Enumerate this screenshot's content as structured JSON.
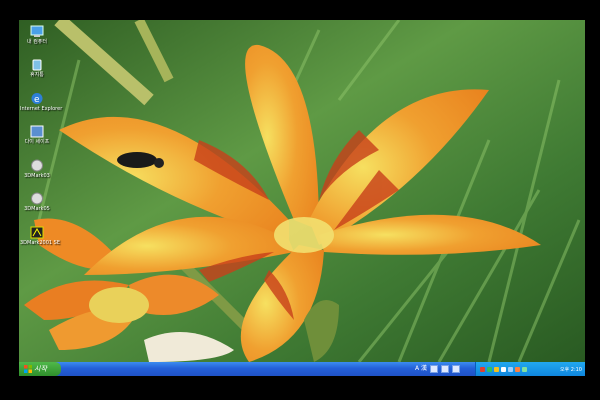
{
  "desktop": {
    "icons": [
      {
        "label": "내 컴퓨터",
        "icon": "my-computer-icon"
      },
      {
        "label": "휴지통",
        "icon": "recycle-bin-icon"
      },
      {
        "label": "Internet Explorer",
        "icon": "internet-explorer-icon"
      },
      {
        "label": "다이 세이프",
        "icon": "shortcut-icon"
      },
      {
        "label": "3DMark03",
        "icon": "3dmark03-icon"
      },
      {
        "label": "3DMark05",
        "icon": "3dmark05-icon"
      },
      {
        "label": "3DMark2001 SE",
        "icon": "3dmark2001-icon"
      }
    ]
  },
  "taskbar": {
    "start_label": "시작",
    "lang_indicator": "A 漢",
    "clock": "오후 2:10"
  },
  "colors": {
    "taskbar": "#2460d8",
    "start": "#3a9e35",
    "tray": "#1496e6"
  }
}
